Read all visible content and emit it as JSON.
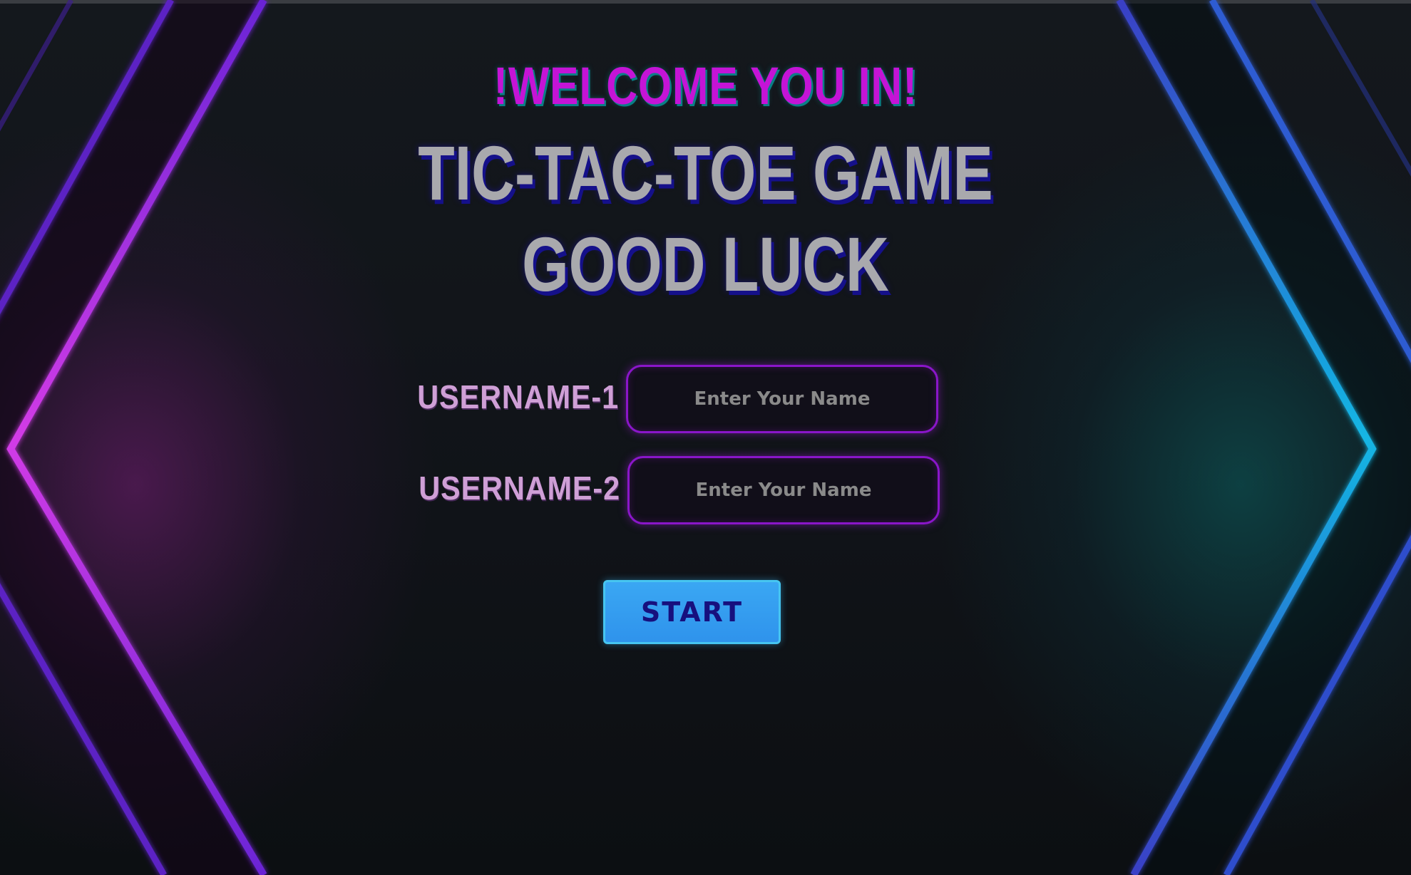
{
  "header": {
    "welcome": "!WELCOME YOU IN!",
    "title": "TIC-TAC-TOE GAME",
    "subtitle": "GOOD LUCK"
  },
  "form": {
    "player1": {
      "label": "USERNAME-1",
      "value": "",
      "placeholder": "Enter Your Name"
    },
    "player2": {
      "label": "USERNAME-2",
      "value": "",
      "placeholder": "Enter Your Name"
    },
    "start_label": "START"
  },
  "colors": {
    "welcome": "#c414d6",
    "title": "#a9a9ad",
    "title_shadow": "#15108a",
    "label": "#cf9fd6",
    "input_border": "#8a16c9",
    "button_bg": "#3aa7f3",
    "button_text": "#17107e",
    "left_glow": "#c43adf",
    "right_glow": "#12b6e3"
  }
}
